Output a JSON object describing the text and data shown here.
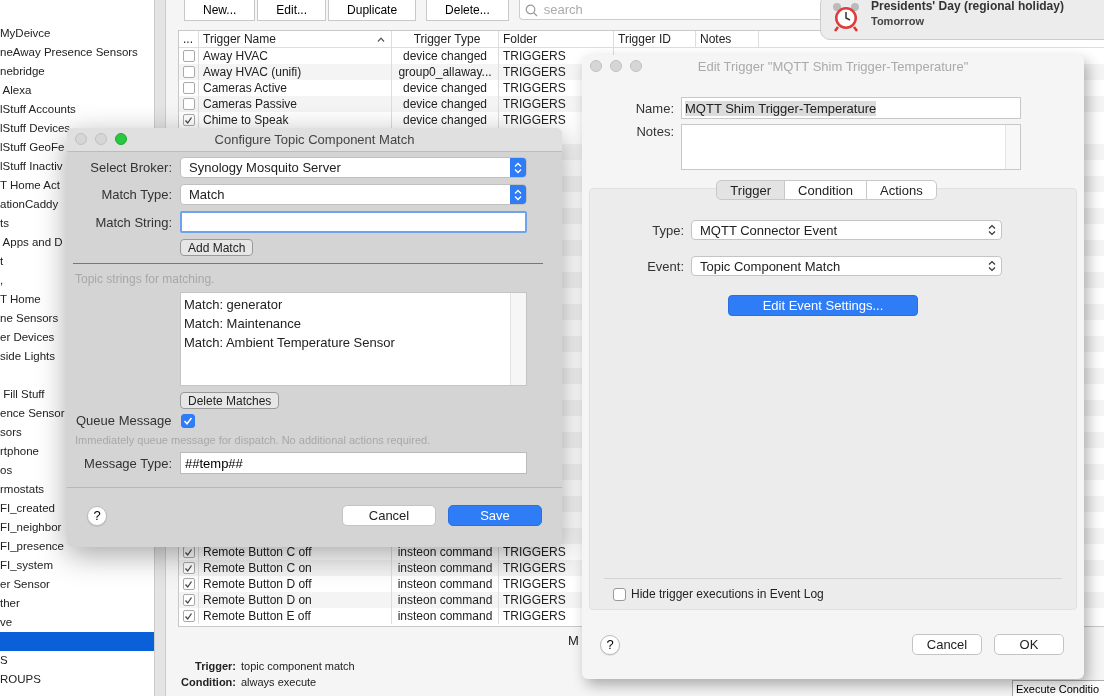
{
  "sidebar": {
    "items": [
      {
        "label": "MyDeivce",
        "selected": false
      },
      {
        "label": "neAway Presence Sensors",
        "selected": false
      },
      {
        "label": "nebridge",
        "selected": false
      },
      {
        "label": " Alexa",
        "selected": false
      },
      {
        "label": "lStuff Accounts",
        "selected": false
      },
      {
        "label": "lStuff Devices",
        "selected": false
      },
      {
        "label": "lStuff GeoFe",
        "selected": false
      },
      {
        "label": "lStuff Inactiv",
        "selected": false
      },
      {
        "label": "T Home Act",
        "selected": false
      },
      {
        "label": "ationCaddy",
        "selected": false
      },
      {
        "label": "ts",
        "selected": false
      },
      {
        "label": " Apps and D",
        "selected": false
      },
      {
        "label": "t",
        "selected": false
      },
      {
        "label": ",",
        "selected": false
      },
      {
        "label": "T Home",
        "selected": false
      },
      {
        "label": "ne Sensors",
        "selected": false
      },
      {
        "label": "er Devices",
        "selected": false
      },
      {
        "label": "side Lights",
        "selected": false
      },
      {
        "selected": false
      },
      {
        "label": " Fill Stuff",
        "selected": false
      },
      {
        "label": "ence Sensor",
        "selected": false
      },
      {
        "label": "sors",
        "selected": false
      },
      {
        "label": "rtphone",
        "selected": false
      },
      {
        "label": "os",
        "selected": false
      },
      {
        "label": "rmostats",
        "selected": false
      },
      {
        "label": "FI_created",
        "selected": false
      },
      {
        "label": "FI_neighbor",
        "selected": false
      },
      {
        "label": "FI_presence",
        "selected": false
      },
      {
        "label": "FI_system",
        "selected": false
      },
      {
        "label": "er Sensor",
        "selected": false
      },
      {
        "label": "ther",
        "selected": false
      },
      {
        "label": "ve",
        "selected": false
      },
      {
        "selected": true
      },
      {
        "label": "S",
        "selected": false
      },
      {
        "label": "ROUPS",
        "selected": false
      }
    ]
  },
  "toolbar": {
    "buttons": [
      "New...",
      "Edit...",
      "Duplicate",
      "Delete..."
    ],
    "search": {
      "placeholder": "search"
    }
  },
  "table": {
    "columns": [
      {
        "label": "..."
      },
      {
        "label": "Trigger Name",
        "sorted": true
      },
      {
        "label": "Trigger Type",
        "sorted": false
      },
      {
        "label": "Folder",
        "sorted": false
      },
      {
        "label": "Trigger ID",
        "sorted": false
      },
      {
        "label": "Notes",
        "sorted": false
      }
    ],
    "rows_top": [
      {
        "enabled": false,
        "name": "Away HVAC",
        "type": "device changed",
        "folder": "TRIGGERS"
      },
      {
        "enabled": false,
        "name": "Away HVAC (unifi)",
        "type": "group0_allaway...",
        "folder": "TRIGGERS"
      },
      {
        "enabled": false,
        "name": "Cameras Active",
        "type": "device changed",
        "folder": "TRIGGERS"
      },
      {
        "enabled": false,
        "name": "Cameras Passive",
        "type": "device changed",
        "folder": "TRIGGERS"
      },
      {
        "enabled": true,
        "name": "Chime to Speak",
        "type": "device changed",
        "folder": "TRIGGERS"
      }
    ],
    "rows_bottom": [
      {
        "enabled": true,
        "name": "Remote Button C off",
        "type": "insteon command",
        "folder": "TRIGGERS"
      },
      {
        "enabled": true,
        "name": "Remote Button C on",
        "type": "insteon command",
        "folder": "TRIGGERS"
      },
      {
        "enabled": true,
        "name": "Remote Button D off",
        "type": "insteon command",
        "folder": "TRIGGERS"
      },
      {
        "enabled": true,
        "name": "Remote Button D on",
        "type": "insteon command",
        "folder": "TRIGGERS"
      },
      {
        "enabled": true,
        "name": "Remote Button E off",
        "type": "insteon command",
        "folder": "TRIGGERS"
      }
    ]
  },
  "details": [
    {
      "label": "Trigger:",
      "value": "topic component match"
    },
    {
      "label": "Condition:",
      "value": "always execute"
    }
  ],
  "partial_label": "M",
  "execute_button": "Execute Conditio",
  "notification": {
    "title": "Presidents' Day (regional holiday)",
    "subtitle": "Tomorrow"
  },
  "configure_match": {
    "title": "Configure Topic Component Match",
    "broker": {
      "label": "Select Broker:",
      "value": "Synology Mosquito Server"
    },
    "match_type": {
      "label": "Match Type:",
      "value": "Match"
    },
    "match_string": {
      "label": "Match String:",
      "focused": true
    },
    "add_button": "Add Match",
    "list_hint": "Topic strings for matching.",
    "matches": [
      "Match: generator",
      "Match: Maintenance",
      "Match: Ambient Temperature Sensor"
    ],
    "delete_button": "Delete Matches",
    "queue": {
      "label": "Queue Message",
      "checked": true,
      "hint": "Immediately queue message for dispatch.  No additional actions required."
    },
    "message_type": {
      "label": "Message Type:",
      "value": "##temp##"
    },
    "help": "?",
    "buttons": [
      {
        "label": "Cancel",
        "default": false
      },
      {
        "label": "Save",
        "default": true
      }
    ]
  },
  "edit_trigger": {
    "title": "Edit Trigger \"MQTT Shim Trigger-Temperature\"",
    "name": {
      "label": "Name:",
      "value": "MQTT Shim Trigger-Temperature"
    },
    "notes": {
      "label": "Notes:"
    },
    "tabs": [
      {
        "label": "Trigger",
        "selected": true
      },
      {
        "label": "Condition",
        "selected": false
      },
      {
        "label": "Actions",
        "selected": false
      }
    ],
    "type": {
      "label": "Type:",
      "value": "MQTT Connector Event"
    },
    "event": {
      "label": "Event:",
      "value": "Topic Component Match"
    },
    "settings_button": "Edit Event Settings...",
    "hide_executions": {
      "label": "Hide trigger executions in Event Log",
      "checked": false
    },
    "help": "?",
    "buttons": [
      {
        "label": "Cancel",
        "default": false
      },
      {
        "label": "OK",
        "default": false
      }
    ]
  }
}
